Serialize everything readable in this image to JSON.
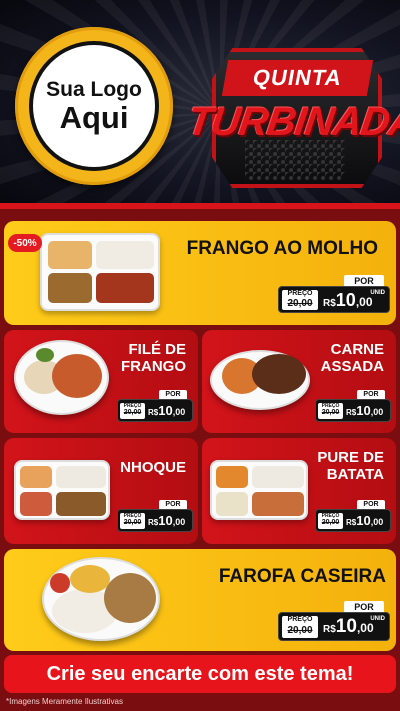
{
  "header": {
    "logo_line1": "Sua Logo",
    "logo_line2": "Aqui",
    "badge_top": "QUINTA",
    "badge_main": "TURBINADA"
  },
  "colors": {
    "brand_red": "#d2141a",
    "brand_yellow": "#f4b10c",
    "dark": "#111111"
  },
  "price_labels": {
    "por": "POR",
    "preco": "PREÇO",
    "unid": "UNID",
    "currency": "R$"
  },
  "items": [
    {
      "name_l1": "FRANGO AO MOLHO",
      "name_l2": "",
      "old_price": "20,00",
      "price_int": "10",
      "price_dec": ",00",
      "discount": "-50%"
    },
    {
      "name_l1": "FILÉ DE",
      "name_l2": "FRANGO",
      "old_price": "20,00",
      "price_int": "10",
      "price_dec": ",00"
    },
    {
      "name_l1": "CARNE",
      "name_l2": "ASSADA",
      "old_price": "20,00",
      "price_int": "10",
      "price_dec": ",00"
    },
    {
      "name_l1": "NHOQUE",
      "name_l2": "",
      "old_price": "20,00",
      "price_int": "10",
      "price_dec": ",00"
    },
    {
      "name_l1": "PURE DE",
      "name_l2": "BATATA",
      "old_price": "20,00",
      "price_int": "10",
      "price_dec": ",00"
    },
    {
      "name_l1": "FAROFA CASEIRA",
      "name_l2": "",
      "old_price": "20,00",
      "price_int": "10",
      "price_dec": ",00"
    }
  ],
  "cta": "Crie seu encarte com este tema!",
  "footer": "*Imagens Meramente Ilustrativas"
}
